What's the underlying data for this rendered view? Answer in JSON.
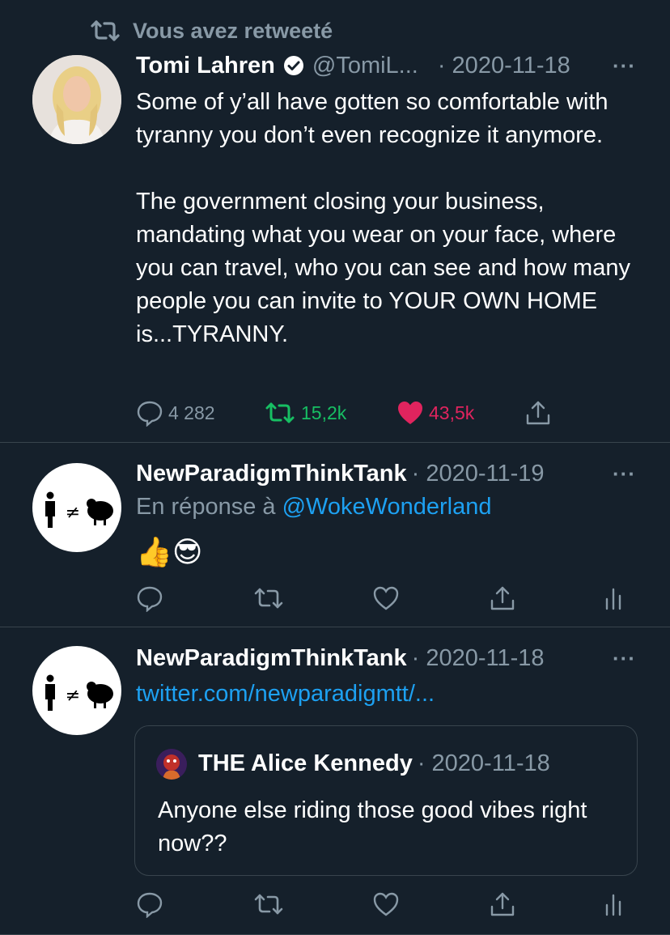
{
  "retweet_banner": {
    "label": "Vous avez retweeté",
    "icon": "retweet-icon"
  },
  "tweets": [
    {
      "author_name": "Tomi Lahren",
      "verified": true,
      "handle": "@TomiL...",
      "date": "· 2020-11-18",
      "more": "···",
      "text": "Some of y’all have gotten so comfortable with tyranny you don’t even recognize it anymore.\n\nThe government closing your business, mandating what you wear on your face, where you can travel, who you can see and how many people you can invite to YOUR OWN HOME is...TYRANNY.",
      "stats": {
        "replies": "4 282",
        "retweets": "15,2k",
        "likes": "43,5k"
      },
      "colors": {
        "retweet": "#17bf63",
        "like": "#e0245e"
      }
    },
    {
      "author_name": "NewParadigmThinkTank",
      "date": "· 2020-11-19",
      "more": "···",
      "reply_prefix": "En réponse à",
      "reply_to": "@WokeWonderland",
      "emojis": "👍😎"
    },
    {
      "author_name": "NewParadigmThinkTank",
      "date": "· 2020-11-18",
      "more": "···",
      "link": "twitter.com/newparadigmtt/...",
      "quote": {
        "author_name": "THE Alice Kennedy",
        "date": "· 2020-11-18",
        "text": "Anyone else riding those good vibes right now??"
      }
    }
  ],
  "avatar_symbol": "≠",
  "colors": {
    "background": "#15202b",
    "muted": "#8899a6",
    "link": "#1da1f2",
    "divider": "#38444d"
  }
}
